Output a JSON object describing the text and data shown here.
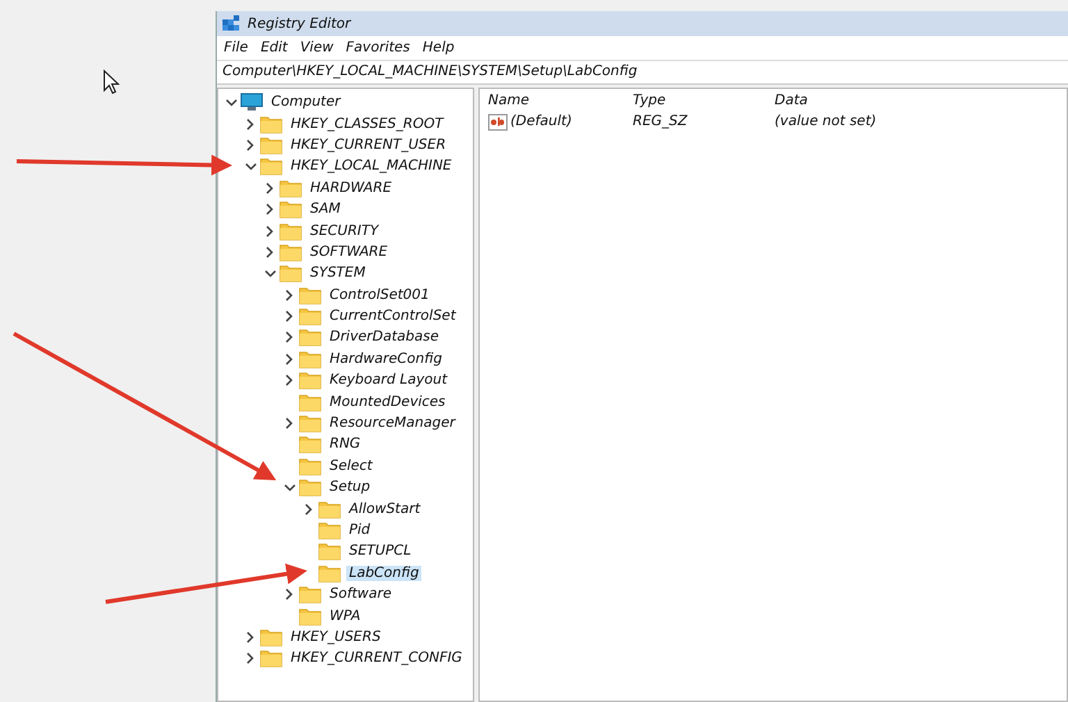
{
  "window": {
    "title": "Registry Editor"
  },
  "menu": [
    "File",
    "Edit",
    "View",
    "Favorites",
    "Help"
  ],
  "address": "Computer\\HKEY_LOCAL_MACHINE\\SYSTEM\\Setup\\LabConfig",
  "tree": [
    {
      "name": "Computer",
      "kind": "computer",
      "expanded": true,
      "selected": false,
      "children": [
        {
          "name": "HKEY_CLASSES_ROOT",
          "kind": "branch",
          "expanded": false,
          "selected": false
        },
        {
          "name": "HKEY_CURRENT_USER",
          "kind": "branch",
          "expanded": false,
          "selected": false
        },
        {
          "name": "HKEY_LOCAL_MACHINE",
          "kind": "branch",
          "expanded": true,
          "selected": false,
          "children": [
            {
              "name": "HARDWARE",
              "kind": "branch",
              "expanded": false,
              "selected": false
            },
            {
              "name": "SAM",
              "kind": "branch",
              "expanded": false,
              "selected": false
            },
            {
              "name": "SECURITY",
              "kind": "branch",
              "expanded": false,
              "selected": false
            },
            {
              "name": "SOFTWARE",
              "kind": "branch",
              "expanded": false,
              "selected": false
            },
            {
              "name": "SYSTEM",
              "kind": "branch",
              "expanded": true,
              "selected": false,
              "children": [
                {
                  "name": "ControlSet001",
                  "kind": "branch",
                  "expanded": false,
                  "selected": false
                },
                {
                  "name": "CurrentControlSet",
                  "kind": "branch",
                  "expanded": false,
                  "selected": false
                },
                {
                  "name": "DriverDatabase",
                  "kind": "branch",
                  "expanded": false,
                  "selected": false
                },
                {
                  "name": "HardwareConfig",
                  "kind": "branch",
                  "expanded": false,
                  "selected": false
                },
                {
                  "name": "Keyboard Layout",
                  "kind": "branch",
                  "expanded": false,
                  "selected": false
                },
                {
                  "name": "MountedDevices",
                  "kind": "leaf",
                  "selected": false
                },
                {
                  "name": "ResourceManager",
                  "kind": "branch",
                  "expanded": false,
                  "selected": false
                },
                {
                  "name": "RNG",
                  "kind": "leaf",
                  "selected": false
                },
                {
                  "name": "Select",
                  "kind": "leaf",
                  "selected": false
                },
                {
                  "name": "Setup",
                  "kind": "branch",
                  "expanded": true,
                  "selected": false,
                  "children": [
                    {
                      "name": "AllowStart",
                      "kind": "branch",
                      "expanded": false,
                      "selected": false
                    },
                    {
                      "name": "Pid",
                      "kind": "leaf",
                      "selected": false
                    },
                    {
                      "name": "SETUPCL",
                      "kind": "leaf",
                      "selected": false
                    },
                    {
                      "name": "LabConfig",
                      "kind": "leaf",
                      "selected": true
                    }
                  ]
                },
                {
                  "name": "Software",
                  "kind": "branch",
                  "expanded": false,
                  "selected": false
                },
                {
                  "name": "WPA",
                  "kind": "leaf",
                  "selected": false
                }
              ]
            }
          ]
        },
        {
          "name": "HKEY_USERS",
          "kind": "branch",
          "expanded": false,
          "selected": false
        },
        {
          "name": "HKEY_CURRENT_CONFIG",
          "kind": "branch",
          "expanded": false,
          "selected": false
        }
      ]
    }
  ],
  "values": {
    "columns": [
      "Name",
      "Type",
      "Data"
    ],
    "rows": [
      {
        "name": "(Default)",
        "type": "REG_SZ",
        "data": "(value not set)"
      }
    ]
  }
}
